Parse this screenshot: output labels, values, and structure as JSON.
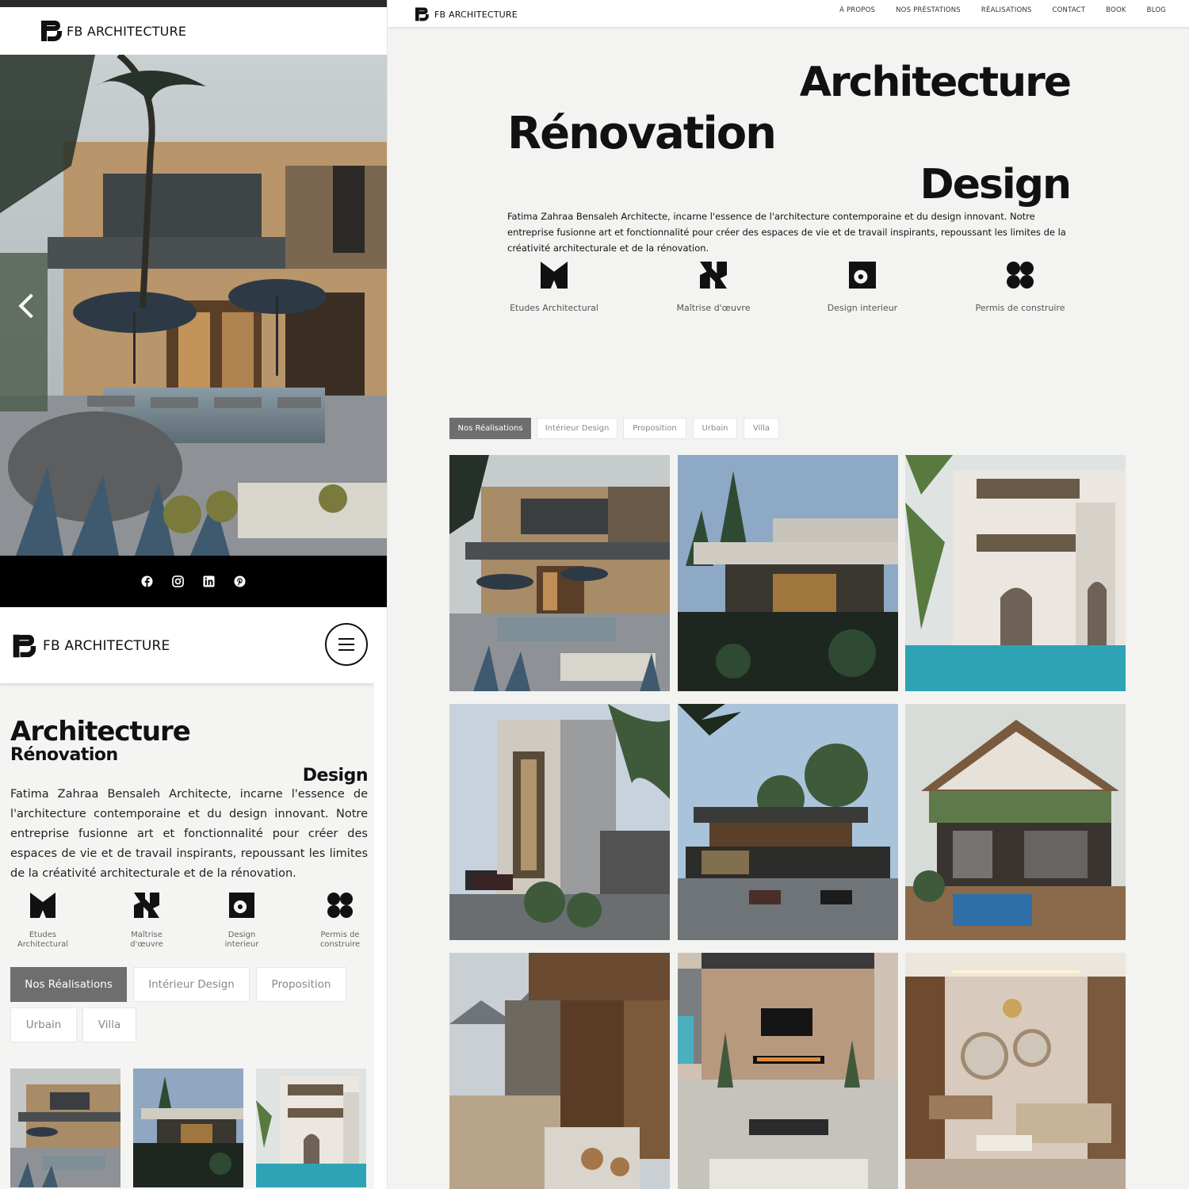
{
  "brand": {
    "name": "FB ARCHITECTURE"
  },
  "nav": {
    "items": [
      "À PROPOS",
      "NOS PRÉSTATIONS",
      "RÉALISATIONS",
      "CONTACT",
      "BOOK",
      "BLOG"
    ]
  },
  "hero": {
    "line1": "Architecture",
    "line2": "Rénovation",
    "line3": "Design",
    "description": "Fatima Zahraa Bensaleh Architecte, incarne l'essence de l'architecture contemporaine et du design innovant. Notre entreprise fusionne art et fonctionnalité pour créer des espaces de vie et de travail inspirants, repoussant les limites de la créativité architecturale et de la rénovation."
  },
  "services": [
    {
      "label": "Etudes Architectural",
      "mobile_label": "Etudes\nArchitectural",
      "icon": "m-shape-icon"
    },
    {
      "label": "Maîtrise d'œuvre",
      "mobile_label": "Maîtrise\nd'œuvre",
      "icon": "notch-square-icon"
    },
    {
      "label": "Design interieur",
      "mobile_label": "Design\ninterieur",
      "icon": "ring-square-icon"
    },
    {
      "label": "Permis de construire",
      "mobile_label": "Permis de\nconstruire",
      "icon": "four-circles-icon"
    }
  ],
  "filters": [
    "Nos Réalisations",
    "Intérieur Design",
    "Proposition",
    "Urbain",
    "Villa"
  ],
  "social": [
    "facebook-icon",
    "instagram-icon",
    "linkedin-icon",
    "pinterest-icon"
  ],
  "gallery": [
    {
      "kind": "villa-stone"
    },
    {
      "kind": "modern-dark"
    },
    {
      "kind": "white-arch"
    },
    {
      "kind": "tall-facade"
    },
    {
      "kind": "hillside"
    },
    {
      "kind": "green-roof-pool"
    },
    {
      "kind": "stone-walkway"
    },
    {
      "kind": "fireplace-patio"
    },
    {
      "kind": "living-room"
    }
  ],
  "colors": {
    "accent_tab": "#6e6e6e",
    "bg": "#f3f3f1",
    "text": "#111111"
  }
}
